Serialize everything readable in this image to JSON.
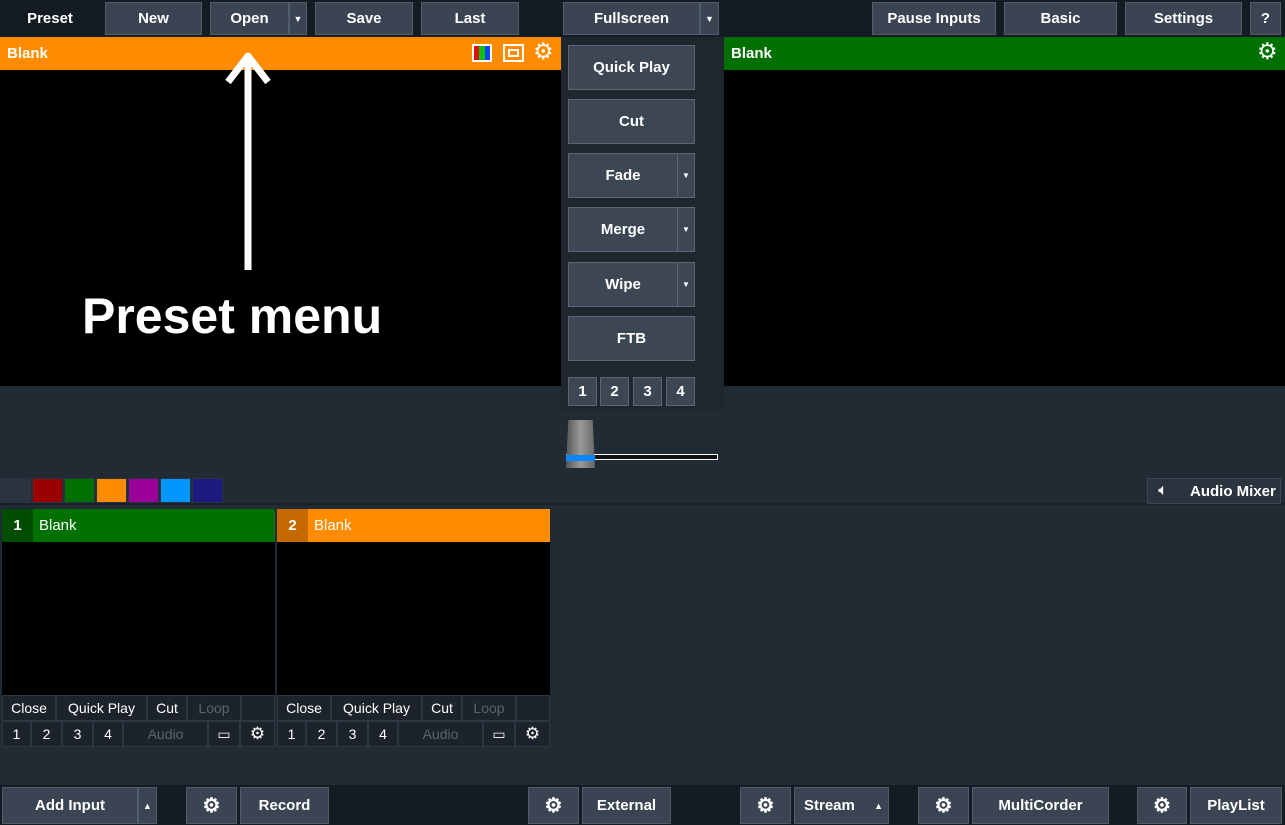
{
  "toolbar": {
    "preset_label": "Preset",
    "new_label": "New",
    "open_label": "Open",
    "save_label": "Save",
    "last_label": "Last",
    "fullscreen_label": "Fullscreen",
    "pause_inputs_label": "Pause Inputs",
    "basic_label": "Basic",
    "settings_label": "Settings",
    "help_label": "?"
  },
  "preview": {
    "title": "Blank",
    "color": "#ff8c00"
  },
  "output": {
    "title": "Blank",
    "color": "#007000"
  },
  "annotation": {
    "text": "Preset menu"
  },
  "transitions": {
    "quick_play": "Quick Play",
    "cut": "Cut",
    "fade": "Fade",
    "merge": "Merge",
    "wipe": "Wipe",
    "ftb": "FTB",
    "numbers": [
      "1",
      "2",
      "3",
      "4"
    ]
  },
  "color_tabs": [
    "#2a3440",
    "#9b0000",
    "#007000",
    "#ff8c00",
    "#9b009b",
    "#0096ff",
    "#1a1a80"
  ],
  "audio_mixer": {
    "label": "Audio Mixer"
  },
  "inputs": [
    {
      "number": "1",
      "name": "Blank",
      "color": "#007000",
      "num_bg": "#004d00",
      "close": "Close",
      "quick_play": "Quick Play",
      "cut": "Cut",
      "loop": "Loop",
      "n1": "1",
      "n2": "2",
      "n3": "3",
      "n4": "4",
      "audio": "Audio"
    },
    {
      "number": "2",
      "name": "Blank",
      "color": "#ff8c00",
      "num_bg": "#c46a00",
      "close": "Close",
      "quick_play": "Quick Play",
      "cut": "Cut",
      "loop": "Loop",
      "n1": "1",
      "n2": "2",
      "n3": "3",
      "n4": "4",
      "audio": "Audio"
    }
  ],
  "bottom": {
    "add_input": "Add Input",
    "record": "Record",
    "external": "External",
    "stream": "Stream",
    "multicorder": "MultiCorder",
    "playlist": "PlayList"
  }
}
